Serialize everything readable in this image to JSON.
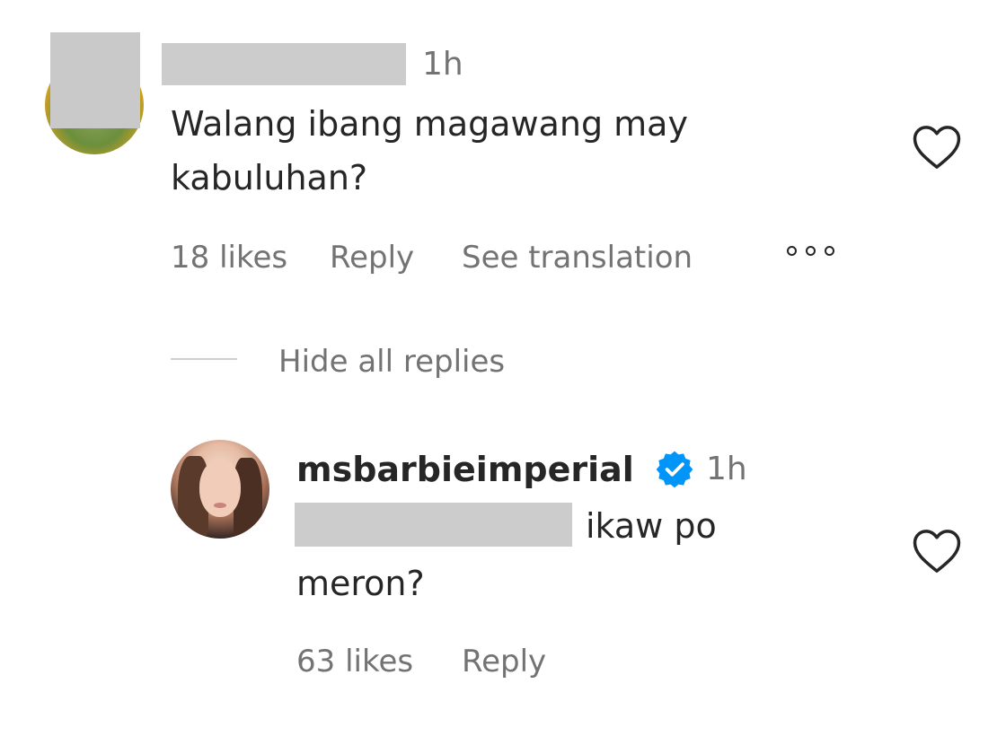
{
  "comment": {
    "time": "1h",
    "text": "Walang ibang magawang may kabuluhan?",
    "likes": "18 likes",
    "reply_label": "Reply",
    "translate_label": "See translation",
    "more_icon": "more-options-icon",
    "heart_icon": "heart-outline-icon"
  },
  "hide_replies": {
    "label": "Hide all replies"
  },
  "reply": {
    "username": "msbarbieimperial",
    "verified_icon": "verified-badge-icon",
    "verified_color": "#0095f6",
    "time": "1h",
    "text_line1": "ikaw po",
    "text_line2": "meron?",
    "likes": "63 likes",
    "reply_label": "Reply",
    "heart_icon": "heart-outline-icon"
  }
}
